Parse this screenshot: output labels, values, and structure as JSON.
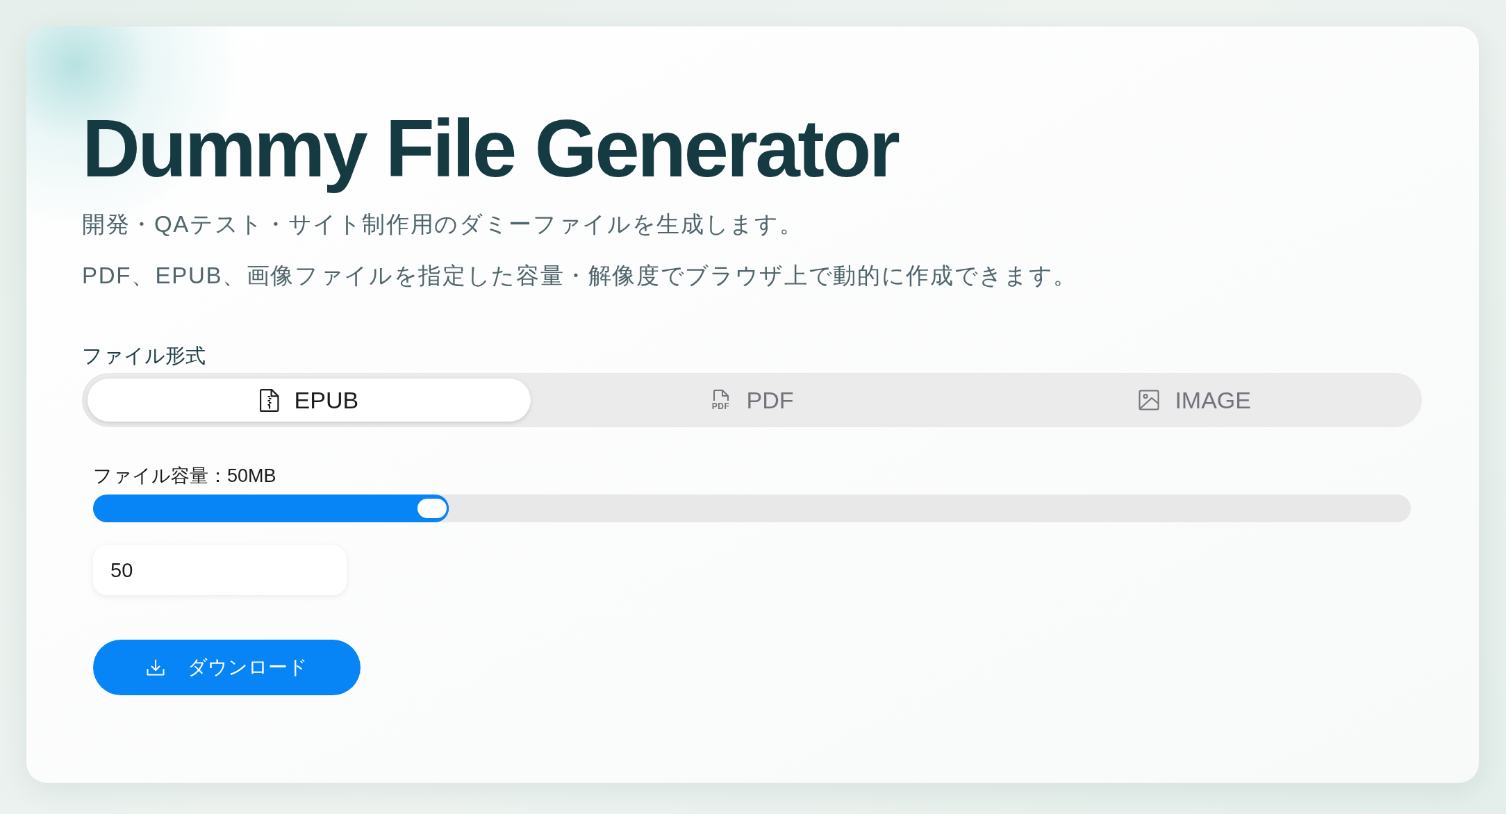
{
  "title": "Dummy File Generator",
  "description": [
    "開発・QAテスト・サイト制作用のダミーファイルを生成します。",
    "PDF、EPUB、画像ファイルを指定した容量・解像度でブラウザ上で動的に作成できます。"
  ],
  "file_format": {
    "label": "ファイル形式",
    "tabs": [
      {
        "kind": "epub",
        "label": "EPUB",
        "selected": true
      },
      {
        "kind": "pdf",
        "icon_text": "PDF",
        "label": "PDF",
        "selected": false
      },
      {
        "kind": "image",
        "label": "IMAGE",
        "selected": false
      }
    ]
  },
  "file_size": {
    "label": "ファイル容量：50MB",
    "level": 0.27,
    "value": "50"
  },
  "download_button": {
    "label": "ダウンロード"
  }
}
